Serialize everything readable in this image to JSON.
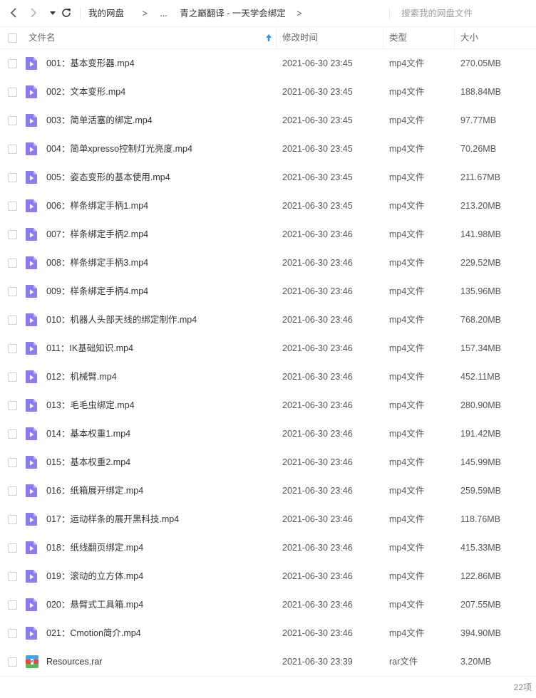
{
  "toolbar": {
    "breadcrumb": [
      "我的网盘",
      "...",
      "青之巅翻译 - 一天学会绑定"
    ],
    "separator": ">",
    "search_placeholder": "搜索我的网盘文件"
  },
  "columns": {
    "name": "文件名",
    "mtime": "修改时间",
    "type": "类型",
    "size": "大小"
  },
  "files": [
    {
      "name": "001：基本变形器.mp4",
      "mtime": "2021-06-30 23:45",
      "type": "mp4文件",
      "size": "270.05MB",
      "icon": "video"
    },
    {
      "name": "002：文本变形.mp4",
      "mtime": "2021-06-30 23:45",
      "type": "mp4文件",
      "size": "188.84MB",
      "icon": "video"
    },
    {
      "name": "003：简单活塞的绑定.mp4",
      "mtime": "2021-06-30 23:45",
      "type": "mp4文件",
      "size": "97.77MB",
      "icon": "video"
    },
    {
      "name": "004：简单xpresso控制灯光亮度.mp4",
      "mtime": "2021-06-30 23:45",
      "type": "mp4文件",
      "size": "70.26MB",
      "icon": "video"
    },
    {
      "name": "005：姿态变形的基本使用.mp4",
      "mtime": "2021-06-30 23:45",
      "type": "mp4文件",
      "size": "211.67MB",
      "icon": "video"
    },
    {
      "name": "006：样条绑定手柄1.mp4",
      "mtime": "2021-06-30 23:45",
      "type": "mp4文件",
      "size": "213.20MB",
      "icon": "video"
    },
    {
      "name": "007：样条绑定手柄2.mp4",
      "mtime": "2021-06-30 23:46",
      "type": "mp4文件",
      "size": "141.98MB",
      "icon": "video"
    },
    {
      "name": "008：样条绑定手柄3.mp4",
      "mtime": "2021-06-30 23:46",
      "type": "mp4文件",
      "size": "229.52MB",
      "icon": "video"
    },
    {
      "name": "009：样条绑定手柄4.mp4",
      "mtime": "2021-06-30 23:46",
      "type": "mp4文件",
      "size": "135.96MB",
      "icon": "video"
    },
    {
      "name": "010：机器人头部天线的绑定制作.mp4",
      "mtime": "2021-06-30 23:46",
      "type": "mp4文件",
      "size": "768.20MB",
      "icon": "video"
    },
    {
      "name": "011：IK基础知识.mp4",
      "mtime": "2021-06-30 23:46",
      "type": "mp4文件",
      "size": "157.34MB",
      "icon": "video"
    },
    {
      "name": "012：机械臂.mp4",
      "mtime": "2021-06-30 23:46",
      "type": "mp4文件",
      "size": "452.11MB",
      "icon": "video"
    },
    {
      "name": "013：毛毛虫绑定.mp4",
      "mtime": "2021-06-30 23:46",
      "type": "mp4文件",
      "size": "280.90MB",
      "icon": "video"
    },
    {
      "name": "014：基本权重1.mp4",
      "mtime": "2021-06-30 23:46",
      "type": "mp4文件",
      "size": "191.42MB",
      "icon": "video"
    },
    {
      "name": "015：基本权重2.mp4",
      "mtime": "2021-06-30 23:46",
      "type": "mp4文件",
      "size": "145.99MB",
      "icon": "video"
    },
    {
      "name": "016：纸箱展开绑定.mp4",
      "mtime": "2021-06-30 23:46",
      "type": "mp4文件",
      "size": "259.59MB",
      "icon": "video"
    },
    {
      "name": "017：运动样条的展开黑科技.mp4",
      "mtime": "2021-06-30 23:46",
      "type": "mp4文件",
      "size": "118.76MB",
      "icon": "video"
    },
    {
      "name": "018：纸线翻页绑定.mp4",
      "mtime": "2021-06-30 23:46",
      "type": "mp4文件",
      "size": "415.33MB",
      "icon": "video"
    },
    {
      "name": "019：滚动的立方体.mp4",
      "mtime": "2021-06-30 23:46",
      "type": "mp4文件",
      "size": "122.86MB",
      "icon": "video"
    },
    {
      "name": "020：悬臂式工具箱.mp4",
      "mtime": "2021-06-30 23:46",
      "type": "mp4文件",
      "size": "207.55MB",
      "icon": "video"
    },
    {
      "name": "021：Cmotion简介.mp4",
      "mtime": "2021-06-30 23:46",
      "type": "mp4文件",
      "size": "394.90MB",
      "icon": "video"
    },
    {
      "name": "Resources.rar",
      "mtime": "2021-06-30 23:39",
      "type": "rar文件",
      "size": "3.20MB",
      "icon": "archive"
    }
  ],
  "footer": {
    "item_count": "22项"
  },
  "colors": {
    "video_icon": "#8a7cf0",
    "archive_icon": "#e8493f"
  }
}
